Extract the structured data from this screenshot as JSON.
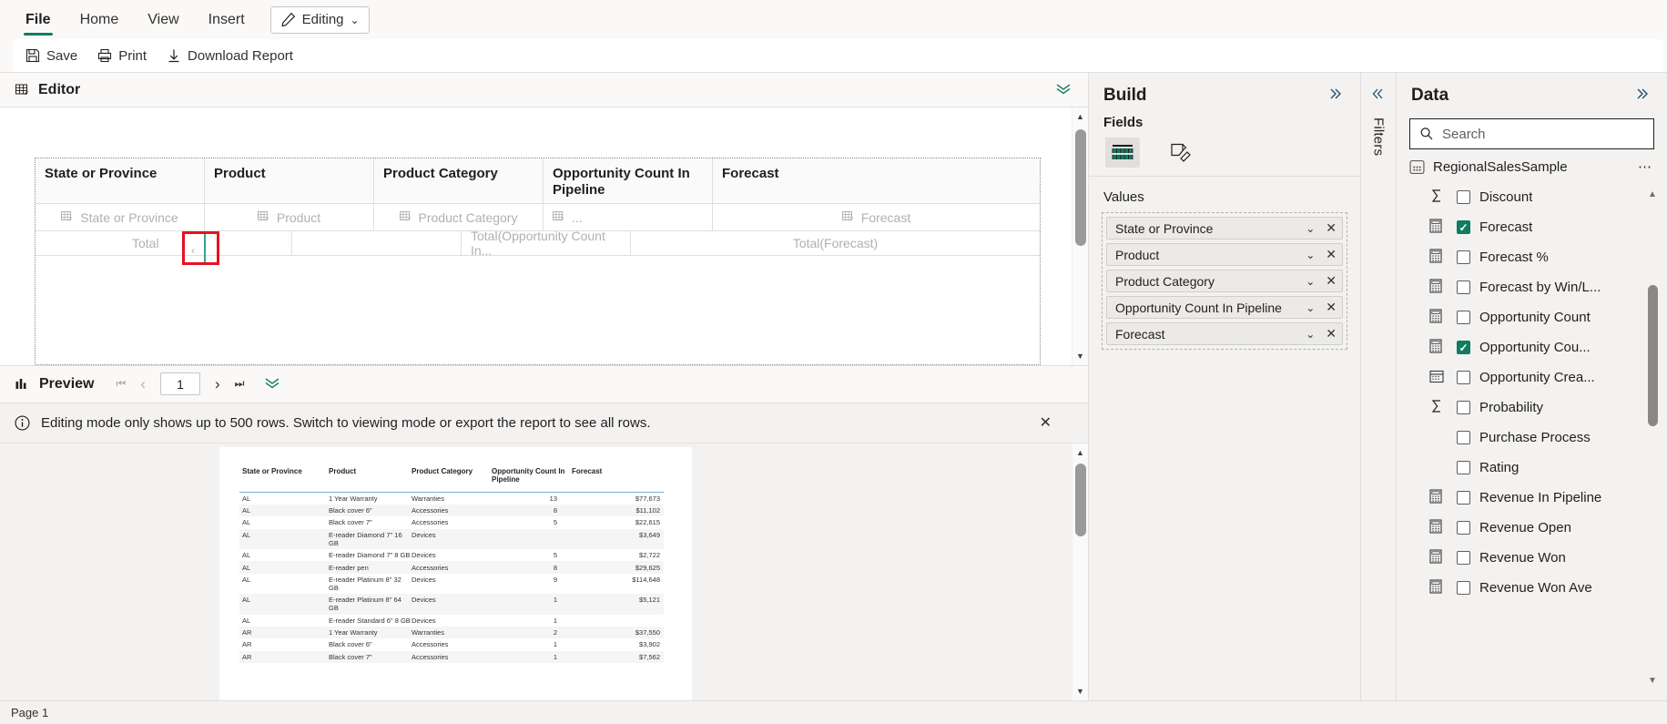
{
  "ribbon": {
    "tabs": [
      {
        "label": "File",
        "active": true
      },
      {
        "label": "Home",
        "active": false
      },
      {
        "label": "View",
        "active": false
      },
      {
        "label": "Insert",
        "active": false
      }
    ],
    "mode_pill": {
      "label": "Editing",
      "chevron": "⌄",
      "icon": "pencil-icon"
    },
    "actions": [
      {
        "label": "Save",
        "icon": "save-icon"
      },
      {
        "label": "Print",
        "icon": "print-icon"
      },
      {
        "label": "Download Report",
        "icon": "download-icon"
      }
    ]
  },
  "editor": {
    "title": "Editor",
    "collapse_icon": "chevron-double-down-icon",
    "matrix": {
      "headers": [
        "State or Province",
        "Product",
        "Product Category",
        "Opportunity Count In Pipeline",
        "Forecast"
      ],
      "placeholders": [
        "State or Province",
        "Product",
        "Product Category",
        "...",
        "Forecast"
      ],
      "totals": [
        "",
        "Total",
        "",
        "Total(Opportunity Count In...",
        "Total(Forecast)"
      ]
    }
  },
  "preview": {
    "title": "Preview",
    "collapse_icon": "chevron-double-down-icon",
    "nav": {
      "first": "⏮",
      "prev": "‹",
      "page_value": "1",
      "next": "›",
      "last": "⏭"
    },
    "info_message": "Editing mode only shows up to 500 rows. Switch to viewing mode or export the report to see all rows.",
    "info_icon": "info-icon",
    "close_icon": "close-icon",
    "table": {
      "headers": [
        "State or Province",
        "Product",
        "Product Category",
        "Opportunity Count In Pipeline",
        "Forecast"
      ],
      "rows": [
        [
          "AL",
          "1 Year Warranty",
          "Warranties",
          "13",
          "$77,673"
        ],
        [
          "AL",
          "Black cover 6\"",
          "Accessories",
          "8",
          "$11,102"
        ],
        [
          "AL",
          "Black cover 7\"",
          "Accessories",
          "5",
          "$22,615"
        ],
        [
          "AL",
          "E-reader Diamond 7\" 16 GB",
          "Devices",
          "",
          "$3,649"
        ],
        [
          "AL",
          "E-reader Diamond 7\" 8 GB",
          "Devices",
          "5",
          "$2,722"
        ],
        [
          "AL",
          "E-reader pen",
          "Accessories",
          "8",
          "$29,625"
        ],
        [
          "AL",
          "E-reader Platinum 8\" 32 GB",
          "Devices",
          "9",
          "$114,648"
        ],
        [
          "AL",
          "E-reader Platinum 8\" 64 GB",
          "Devices",
          "1",
          "$5,121"
        ],
        [
          "AL",
          "E-reader Standard 6\" 8 GB",
          "Devices",
          "1",
          ""
        ],
        [
          "AR",
          "1 Year Warranty",
          "Warranties",
          "2",
          "$37,550"
        ],
        [
          "AR",
          "Black cover 6\"",
          "Accessories",
          "1",
          "$3,902"
        ],
        [
          "AR",
          "Black cover 7\"",
          "Accessories",
          "1",
          "$7,562"
        ]
      ]
    }
  },
  "build": {
    "title": "Build",
    "expand_icon": "chevron-double-right-icon",
    "fields_label": "Fields",
    "icons": [
      {
        "name": "data-fields-icon",
        "selected": true
      },
      {
        "name": "format-brush-icon",
        "selected": false
      }
    ],
    "values_label": "Values",
    "values": [
      {
        "label": "State or Province",
        "chevron": "⌄",
        "close": "✕"
      },
      {
        "label": "Product",
        "chevron": "⌄",
        "close": "✕"
      },
      {
        "label": "Product Category",
        "chevron": "⌄",
        "close": "✕"
      },
      {
        "label": "Opportunity Count In Pipeline",
        "chevron": "⌄",
        "close": "✕"
      },
      {
        "label": "Forecast",
        "chevron": "⌄",
        "close": "✕"
      }
    ]
  },
  "filters_rail": {
    "collapse_icon": "chevron-double-left-icon",
    "label": "Filters"
  },
  "data_panel": {
    "title": "Data",
    "expand_icon": "chevron-double-right-icon",
    "search": {
      "placeholder": "Search",
      "value": "",
      "icon": "search-icon"
    },
    "table_name": "RegionalSalesSample",
    "table_icon": "table-icon",
    "more_icon": "more-options-icon",
    "fields": [
      {
        "label": "Discount",
        "checked": false,
        "icon": "sigma-icon"
      },
      {
        "label": "Forecast",
        "checked": true,
        "icon": "measure-icon"
      },
      {
        "label": "Forecast %",
        "checked": false,
        "icon": "measure-icon"
      },
      {
        "label": "Forecast by Win/L...",
        "checked": false,
        "icon": "measure-icon"
      },
      {
        "label": "Opportunity Count",
        "checked": false,
        "icon": "measure-icon"
      },
      {
        "label": "Opportunity Cou...",
        "checked": true,
        "icon": "measure-icon"
      },
      {
        "label": "Opportunity Crea...",
        "checked": false,
        "icon": "calendar-icon"
      },
      {
        "label": "Probability",
        "checked": false,
        "icon": "sigma-icon"
      },
      {
        "label": "Purchase Process",
        "checked": false,
        "icon": "none"
      },
      {
        "label": "Rating",
        "checked": false,
        "icon": "none"
      },
      {
        "label": "Revenue In Pipeline",
        "checked": false,
        "icon": "measure-icon"
      },
      {
        "label": "Revenue Open",
        "checked": false,
        "icon": "measure-icon"
      },
      {
        "label": "Revenue Won",
        "checked": false,
        "icon": "measure-icon"
      },
      {
        "label": "Revenue Won Ave",
        "checked": false,
        "icon": "measure-icon"
      }
    ]
  },
  "statusbar": {
    "page_label": "Page 1"
  },
  "colors": {
    "accent_green": "#107c61",
    "annotation_red": "#e81123",
    "panel_bg": "#f3f2f1",
    "handle_teal": "#2aa591"
  }
}
